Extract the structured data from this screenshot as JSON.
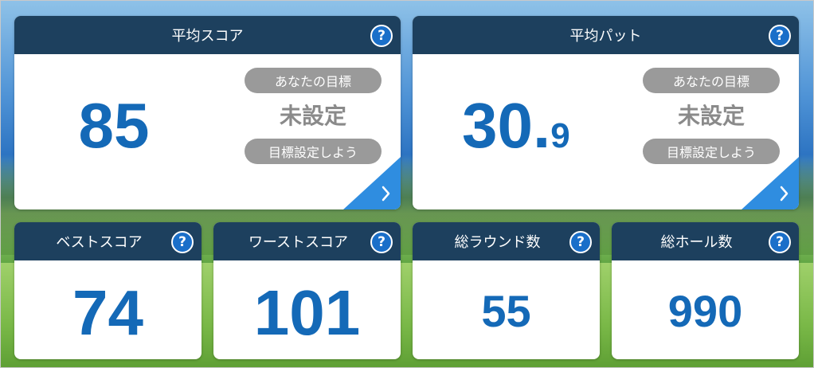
{
  "colors": {
    "header_bg": "#1d405e",
    "accent_blue": "#1469b7",
    "help_icon_bg": "#1a6fc9",
    "pill_gray": "#9a9a9a",
    "status_gray": "#8a8a8a",
    "corner_blue": "#2f8de0"
  },
  "icons": {
    "help": "question-circle-icon",
    "corner": "chevron-right-icon"
  },
  "avg_score": {
    "title": "平均スコア",
    "help": "?",
    "value": "85",
    "goal_label": "あなたの目標",
    "goal_status": "未設定",
    "goal_button": "目標設定しよう",
    "arrow": "›"
  },
  "avg_putt": {
    "title": "平均パット",
    "help": "?",
    "value_int": "30.",
    "value_dec": "9",
    "goal_label": "あなたの目標",
    "goal_status": "未設定",
    "goal_button": "目標設定しよう",
    "arrow": "›"
  },
  "best_score": {
    "title": "ベストスコア",
    "help": "?",
    "value": "74"
  },
  "worst_score": {
    "title": "ワーストスコア",
    "help": "?",
    "value": "101"
  },
  "total_rounds": {
    "title": "総ラウンド数",
    "help": "?",
    "value": "55"
  },
  "total_holes": {
    "title": "総ホール数",
    "help": "?",
    "value": "990"
  }
}
